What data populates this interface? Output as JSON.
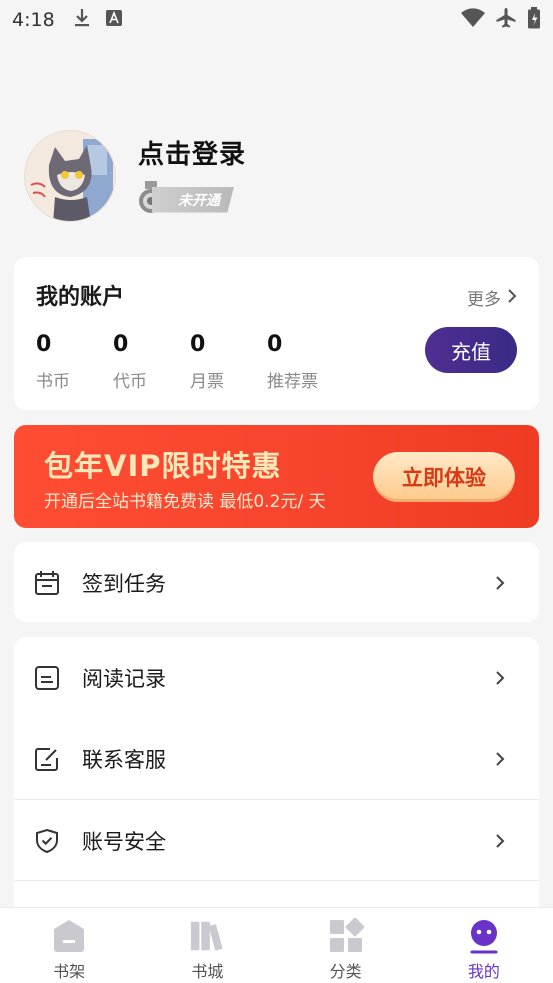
{
  "status_bar": {
    "time": "4:18"
  },
  "profile": {
    "login_text": "点击登录",
    "vip_status": "未开通"
  },
  "account": {
    "title": "我的账户",
    "more": "更多",
    "stats": [
      {
        "value": "0",
        "label": "书币"
      },
      {
        "value": "0",
        "label": "代币"
      },
      {
        "value": "0",
        "label": "月票"
      },
      {
        "value": "0",
        "label": "推荐票"
      }
    ],
    "recharge": "充值"
  },
  "banner": {
    "title": "包年VIP限时特惠",
    "subtitle": "开通后全站书籍免费读 最低0.2元/ 天",
    "button": "立即体验"
  },
  "menu": {
    "checkin": "签到任务",
    "history": "阅读记录",
    "service": "联系客服",
    "security": "账号安全"
  },
  "nav": {
    "items": [
      {
        "label": "书架"
      },
      {
        "label": "书城"
      },
      {
        "label": "分类"
      },
      {
        "label": "我的"
      }
    ]
  },
  "colors": {
    "accent": "#6a32c9",
    "recharge": "#4a2d8e",
    "banner": "#f7452d"
  }
}
